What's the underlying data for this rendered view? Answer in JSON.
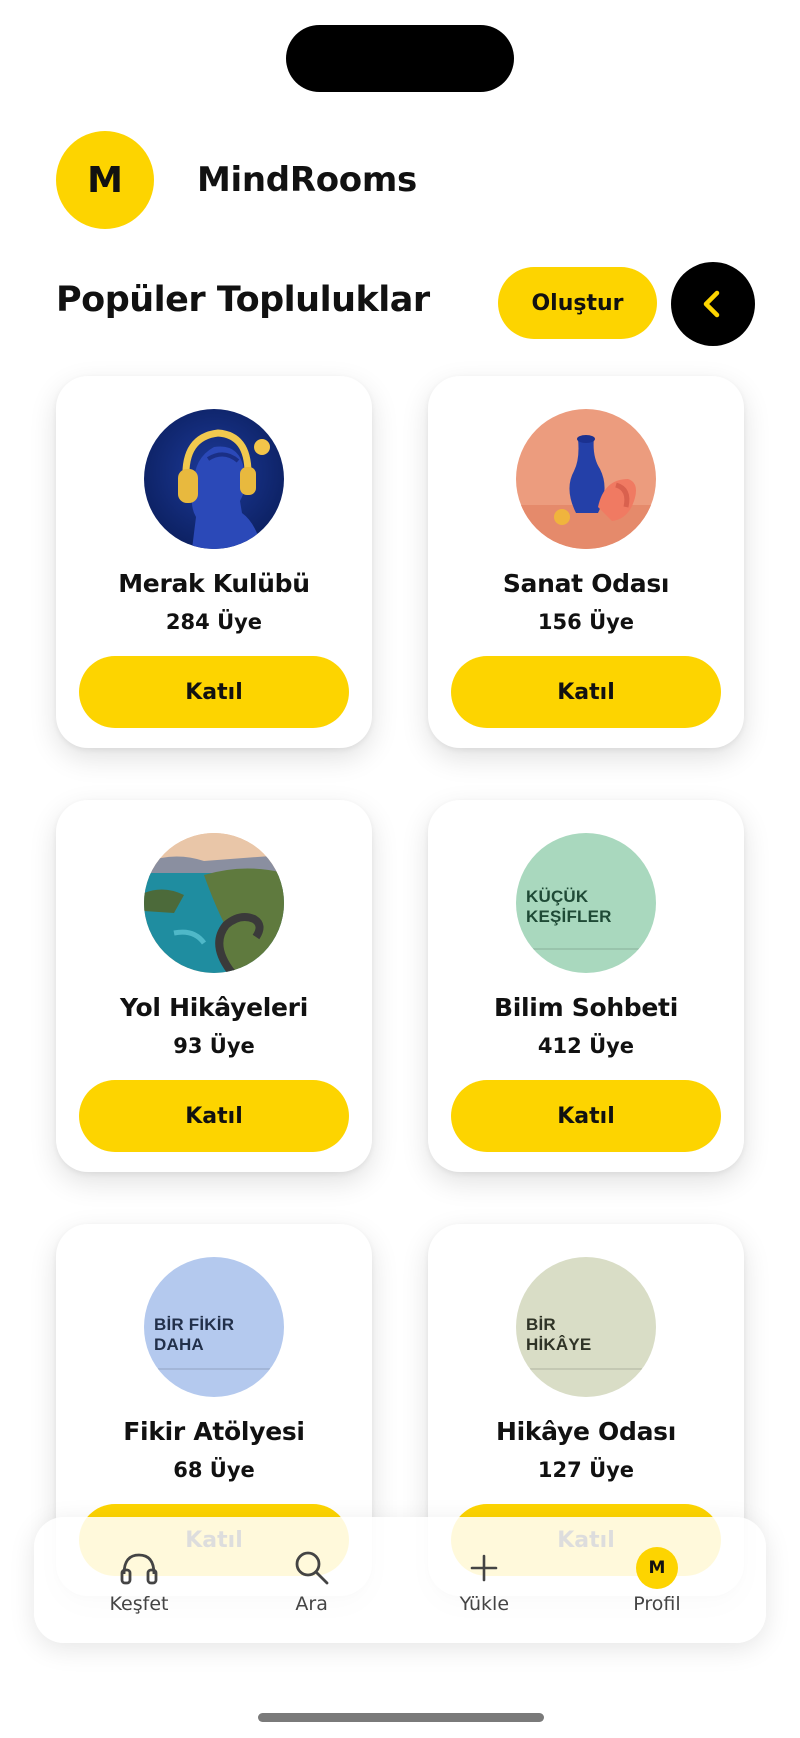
{
  "header": {
    "logo_letter": "M",
    "app_name": "MindRooms"
  },
  "section": {
    "title": "Popüler Topluluklar",
    "create_label": "Oluştur",
    "back_icon": "chevron-left-icon"
  },
  "communities": [
    {
      "name": "Merak Kulübü",
      "members": "284 Üye",
      "join_label": "Katıl",
      "image": "statue-headphones"
    },
    {
      "name": "Sanat Odası",
      "members": "156 Üye",
      "join_label": "Katıl",
      "image": "vase-sculpture"
    },
    {
      "name": "Yol Hikâyeleri",
      "members": "93 Üye",
      "join_label": "Katıl",
      "image": "coastal-road"
    },
    {
      "name": "Bilim Sohbeti",
      "members": "412 Üye",
      "join_label": "Katıl",
      "image": "poster",
      "poster_text": [
        "KÜÇÜK",
        "KEŞİFLER"
      ],
      "poster_color": "#A9D8BE"
    },
    {
      "name": "Fikir Atölyesi",
      "members": "68 Üye",
      "join_label": "Katıl",
      "image": "poster",
      "poster_text": [
        "BİR FİKİR",
        "DAHA"
      ],
      "poster_color": "#B4C9EE"
    },
    {
      "name": "Hikâye Odası",
      "members": "127 Üye",
      "join_label": "Katıl",
      "image": "poster",
      "poster_text": [
        "BİR",
        "HİKÂYE"
      ],
      "poster_color": "#D9DDC6"
    }
  ],
  "tabbar": {
    "items": [
      {
        "label": "Keşfet",
        "icon": "headphones-icon"
      },
      {
        "label": "Ara",
        "icon": "search-icon"
      },
      {
        "label": "Yükle",
        "icon": "plus-icon"
      },
      {
        "label": "Profil",
        "icon": "profile-avatar",
        "avatar_letter": "M"
      }
    ]
  },
  "colors": {
    "accent": "#FDD400",
    "text": "#111111",
    "background": "#FFFFFF"
  }
}
